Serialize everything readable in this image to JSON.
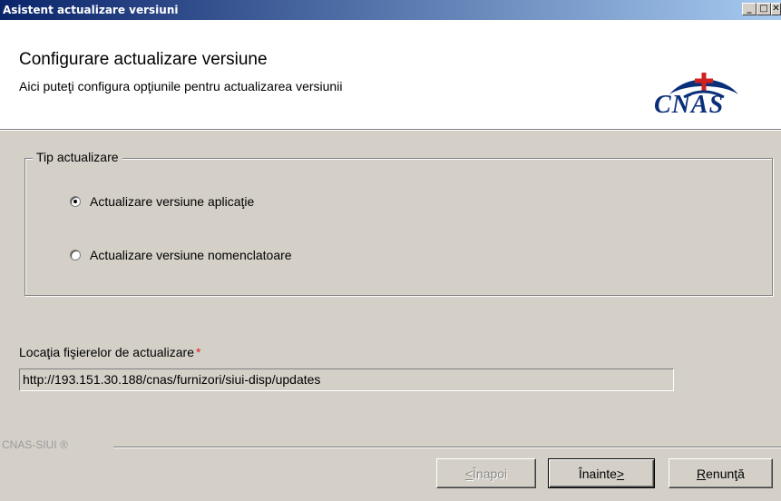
{
  "window": {
    "title": "Asistent actualizare versiuni",
    "controls": {
      "minimize": "_",
      "maximize": "□",
      "close": "✕"
    }
  },
  "header": {
    "title": "Configurare actualizare versiune",
    "subtitle": "Aici puteţi configura opţiunile pentru actualizarea versiunii",
    "logo_text": "CNAS"
  },
  "update_type": {
    "group_label": "Tip actualizare",
    "options": [
      {
        "label": "Actualizare versiune aplicaţie",
        "selected": true
      },
      {
        "label": "Actualizare versiune nomenclatoare",
        "selected": false
      }
    ]
  },
  "location": {
    "label": "Locaţia fişierelor de actualizare",
    "required_mark": "*",
    "value": "http://193.151.30.188/cnas/furnizori/siui-disp/updates"
  },
  "footer": {
    "brand": "CNAS-SIUI ®"
  },
  "buttons": {
    "back": {
      "prefix": "< ",
      "label": "Înapoi",
      "enabled": false
    },
    "next": {
      "label": "Înainte ",
      "suffix": ">",
      "enabled": true
    },
    "cancel": {
      "first": "R",
      "label": "enunţă",
      "enabled": true
    }
  },
  "colors": {
    "titlebar_start": "#0a246a",
    "titlebar_end": "#a6caf0",
    "dialog_bg": "#d4d0c8",
    "logo_blue": "#0a2f7a",
    "logo_red": "#d02020",
    "required": "#e02020"
  }
}
